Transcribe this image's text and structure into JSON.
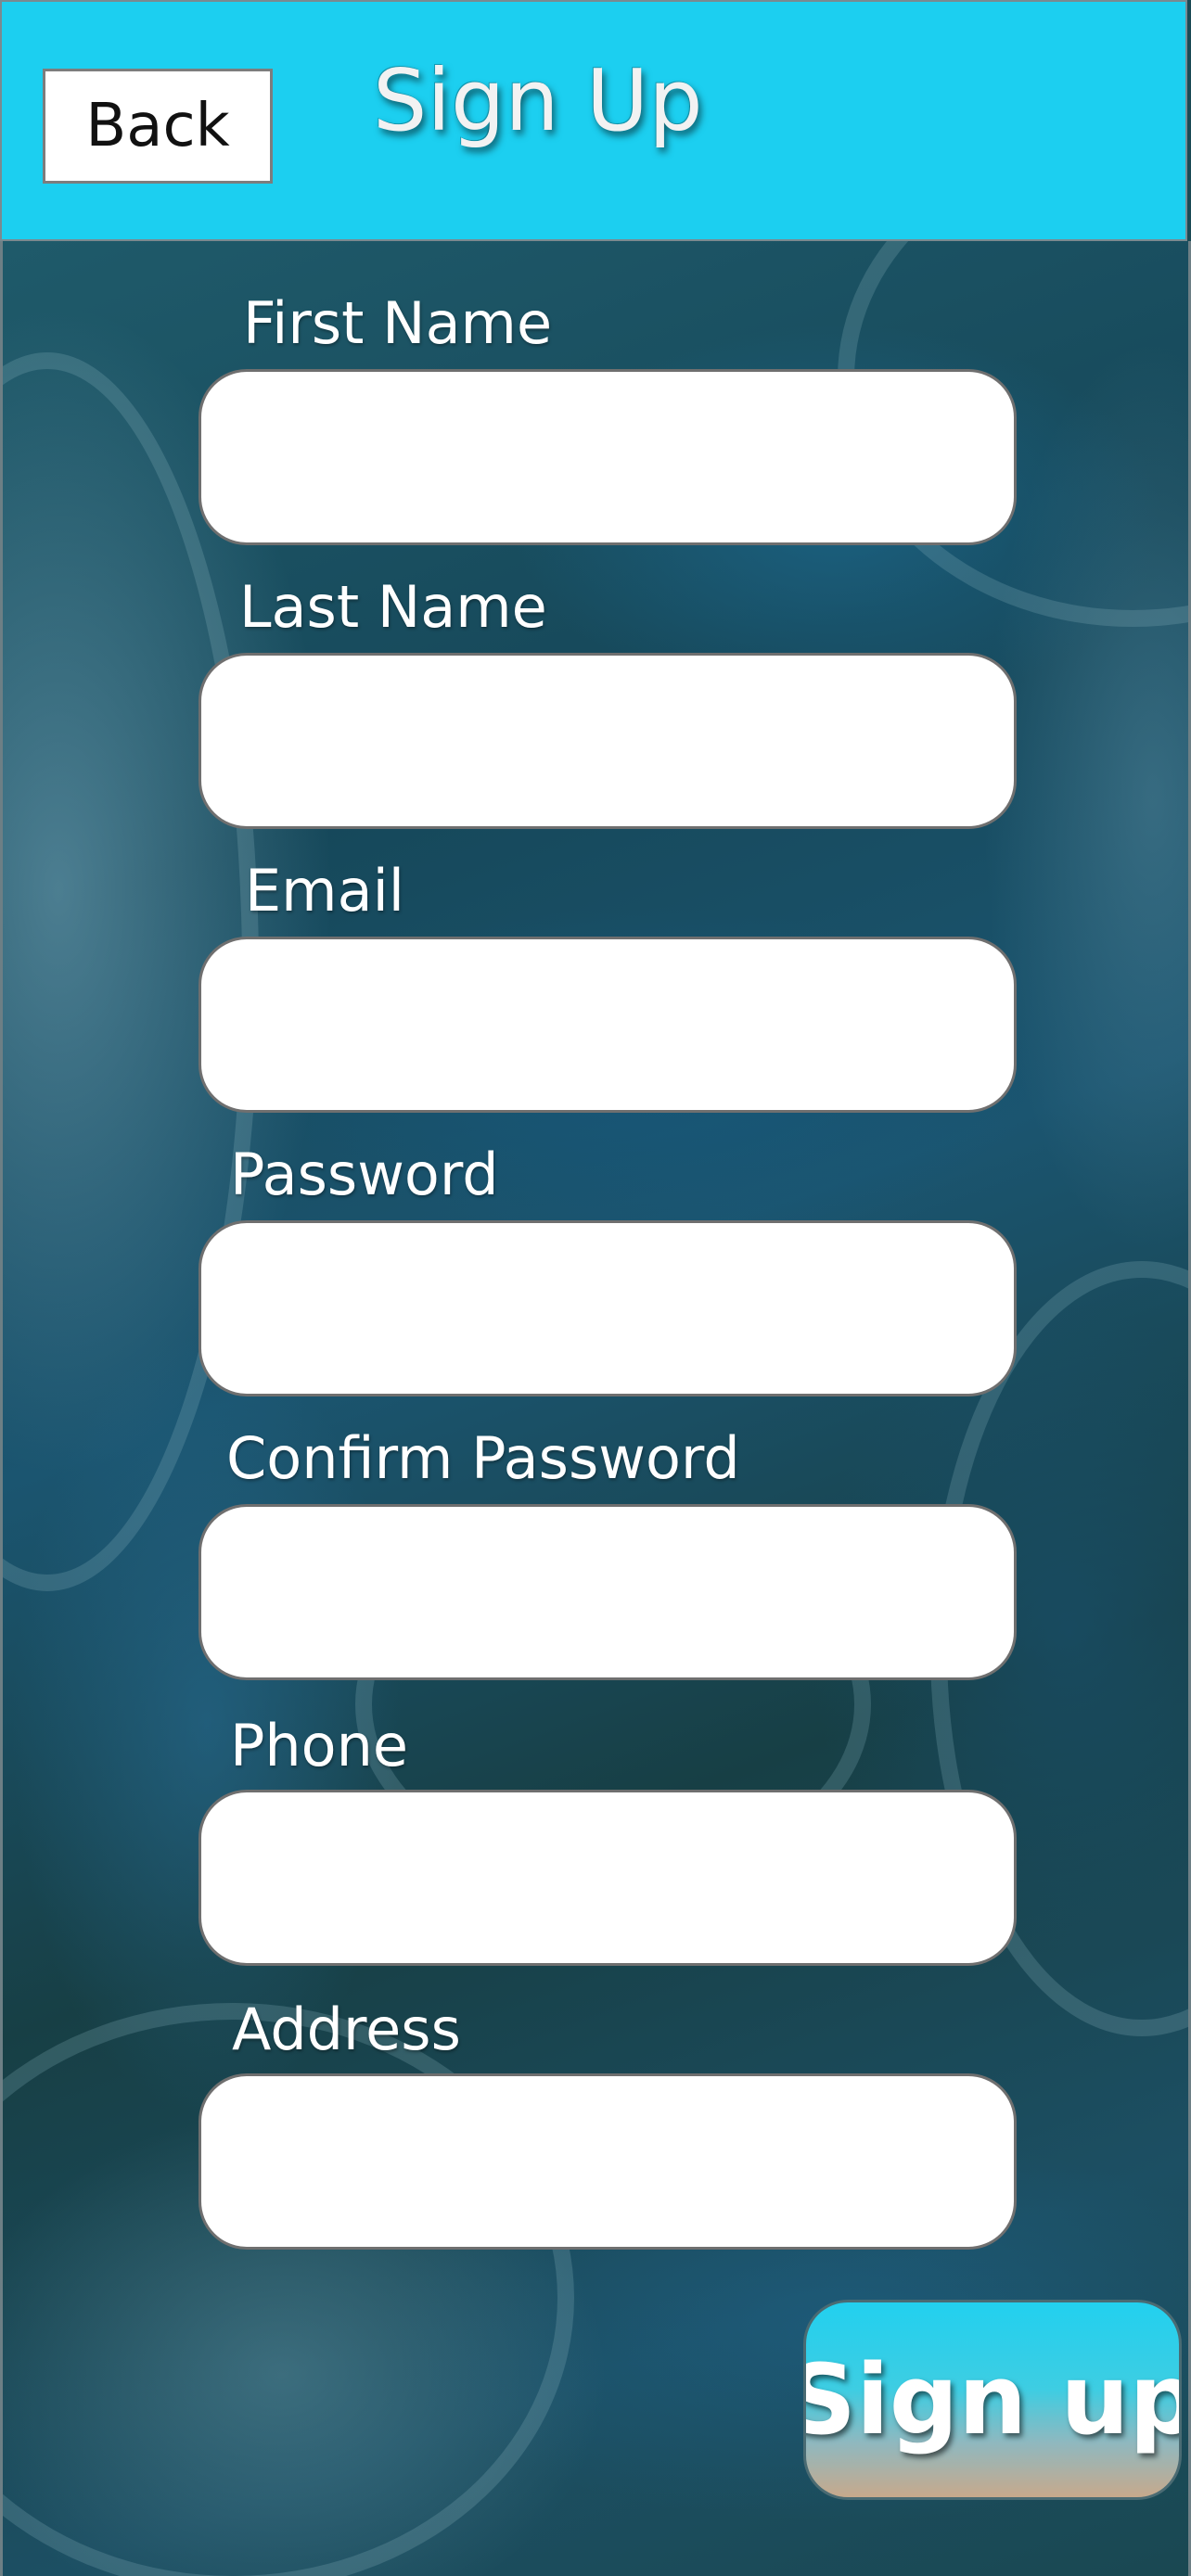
{
  "header": {
    "back_label": "Back",
    "title": "Sign Up",
    "background_color": "#1ccff0"
  },
  "form": {
    "fields": [
      {
        "label": "First Name",
        "value": "",
        "placeholder": ""
      },
      {
        "label": "Last Name",
        "value": "",
        "placeholder": ""
      },
      {
        "label": "Email",
        "value": "",
        "placeholder": ""
      },
      {
        "label": "Password",
        "value": "",
        "placeholder": ""
      },
      {
        "label": "Confirm Password",
        "value": "",
        "placeholder": ""
      },
      {
        "label": "Phone",
        "value": "",
        "placeholder": ""
      },
      {
        "label": "Address",
        "value": "",
        "placeholder": ""
      }
    ],
    "submit_label": "Sign up"
  },
  "colors": {
    "accent": "#1ccff0",
    "input_background": "#ffffff",
    "label_text": "#ffffff"
  }
}
